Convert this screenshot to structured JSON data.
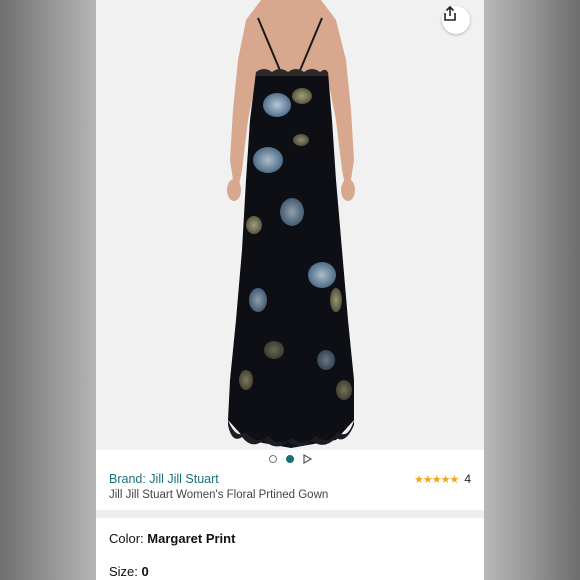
{
  "product": {
    "brand_label": "Brand: Jill Jill Stuart",
    "title": "Jill Jill Stuart Women's Floral Prtined Gown",
    "rating_count": "4",
    "rating_value": 4.5,
    "rating_stars": "★★★★★"
  },
  "carousel": {
    "image_count": 2,
    "active_index": 1,
    "has_video": true
  },
  "options": {
    "color_label": "Color: ",
    "color_value": "Margaret Print",
    "size_label": "Size: ",
    "size_value": "0"
  },
  "icons": {
    "share": "share-icon",
    "play": "play-icon"
  },
  "colors": {
    "brand_link": "#1b6f7a",
    "star": "#f4a41c",
    "active_dot": "#1b6f7a"
  }
}
